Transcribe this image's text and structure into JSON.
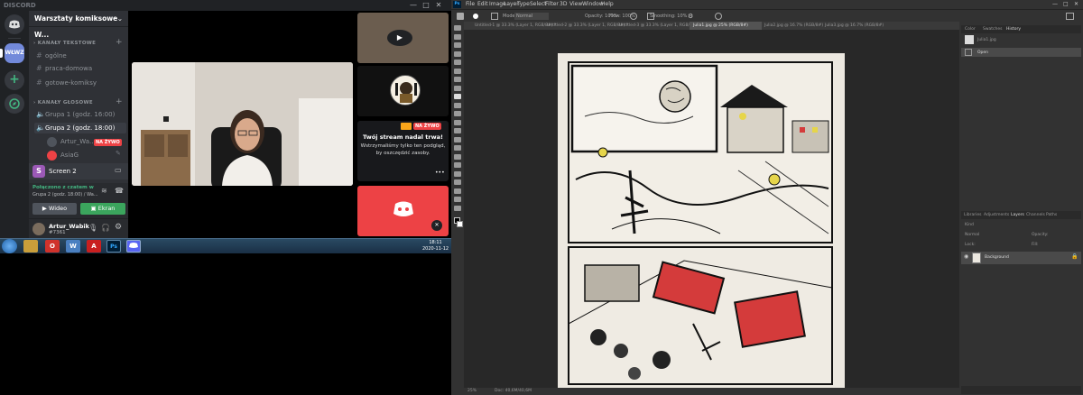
{
  "discord": {
    "wordmark": "DISCORD",
    "window_controls": [
      "—",
      "□",
      "✕"
    ],
    "guilds": [
      {
        "label": "WŁWZ"
      }
    ],
    "server_name": "Warsztaty komiksowe W...",
    "text_category": "KANAŁY TEKSTOWE",
    "text_channels": [
      "ogólne",
      "praca-domowa",
      "gotowe-komiksy"
    ],
    "voice_category": "KANAŁY GŁOSOWE",
    "voice_channels": [
      "Grupa 1 (godz. 16:00)",
      "Grupa 2 (godz. 18:00)"
    ],
    "voice_users": [
      {
        "name": "Artur_Wa...",
        "badge": "NA ŻYWO"
      },
      {
        "name": "AsiaG"
      }
    ],
    "screen_item": {
      "icon_letter": "S",
      "label": "Screen 2"
    },
    "connection": {
      "status": "Połączono z czatem w",
      "location": "Grupa 2 (godz. 18:00) / Wa..."
    },
    "buttons": {
      "video": "Wideo",
      "screen": "Ekran"
    },
    "user": {
      "name": "Artur_Wabik",
      "tag": "#7361"
    },
    "paused_stream": {
      "badge": "NA ŻYWO",
      "title": "Twój stream nadal trwa!",
      "body": "Wstrzymaliśmy tylko ten podgląd, by oszczędzić zasoby.",
      "more": "•••"
    }
  },
  "taskbar": {
    "apps": [
      "O",
      "W",
      "A",
      "Ps"
    ],
    "time": "18:11",
    "date": "2020-11-12"
  },
  "photoshop": {
    "logo": "Ps",
    "menu": [
      "File",
      "Edit",
      "Image",
      "Layer",
      "Type",
      "Select",
      "Filter",
      "3D",
      "View",
      "Window",
      "Help"
    ],
    "options": {
      "mode_label": "Mode:",
      "mode": "Normal",
      "opacity": "Opacity: 100%",
      "flow": "Flow: 100%",
      "smoothing": "Smoothing: 10%"
    },
    "doc_tabs": [
      "Untitled-1 @ 33.3% (Layer 1, RGB/8#) *",
      "Untitled-2 @ 33.3% (Layer 1, RGB/8#) *",
      "Untitled-3 @ 33.3% (Layer 1, RGB/8#) *",
      "Julia1.jpg @ 25% (RGB/8#)",
      "Julia2.jpg @ 16.7% (RGB/8#)",
      "Julia3.jpg @ 16.7% (RGB/8#)"
    ],
    "active_tab_index": 3,
    "status": {
      "zoom": "25%",
      "doc": "Doc: 40,6M/40,6M"
    },
    "history_tabs": [
      "Color",
      "Swatches",
      "History"
    ],
    "history_items": [
      "Julia1.jpg",
      "Open"
    ],
    "layers_tabs": [
      "Libraries",
      "Adjustments",
      "Layers",
      "Channels",
      "Paths"
    ],
    "layers_kind": "Kind",
    "layer_blend": "Normal",
    "layer_opacity": "Opacity:",
    "layer_lock": "Lock:",
    "layer_fill": "Fill:",
    "layer_name": "Background"
  }
}
